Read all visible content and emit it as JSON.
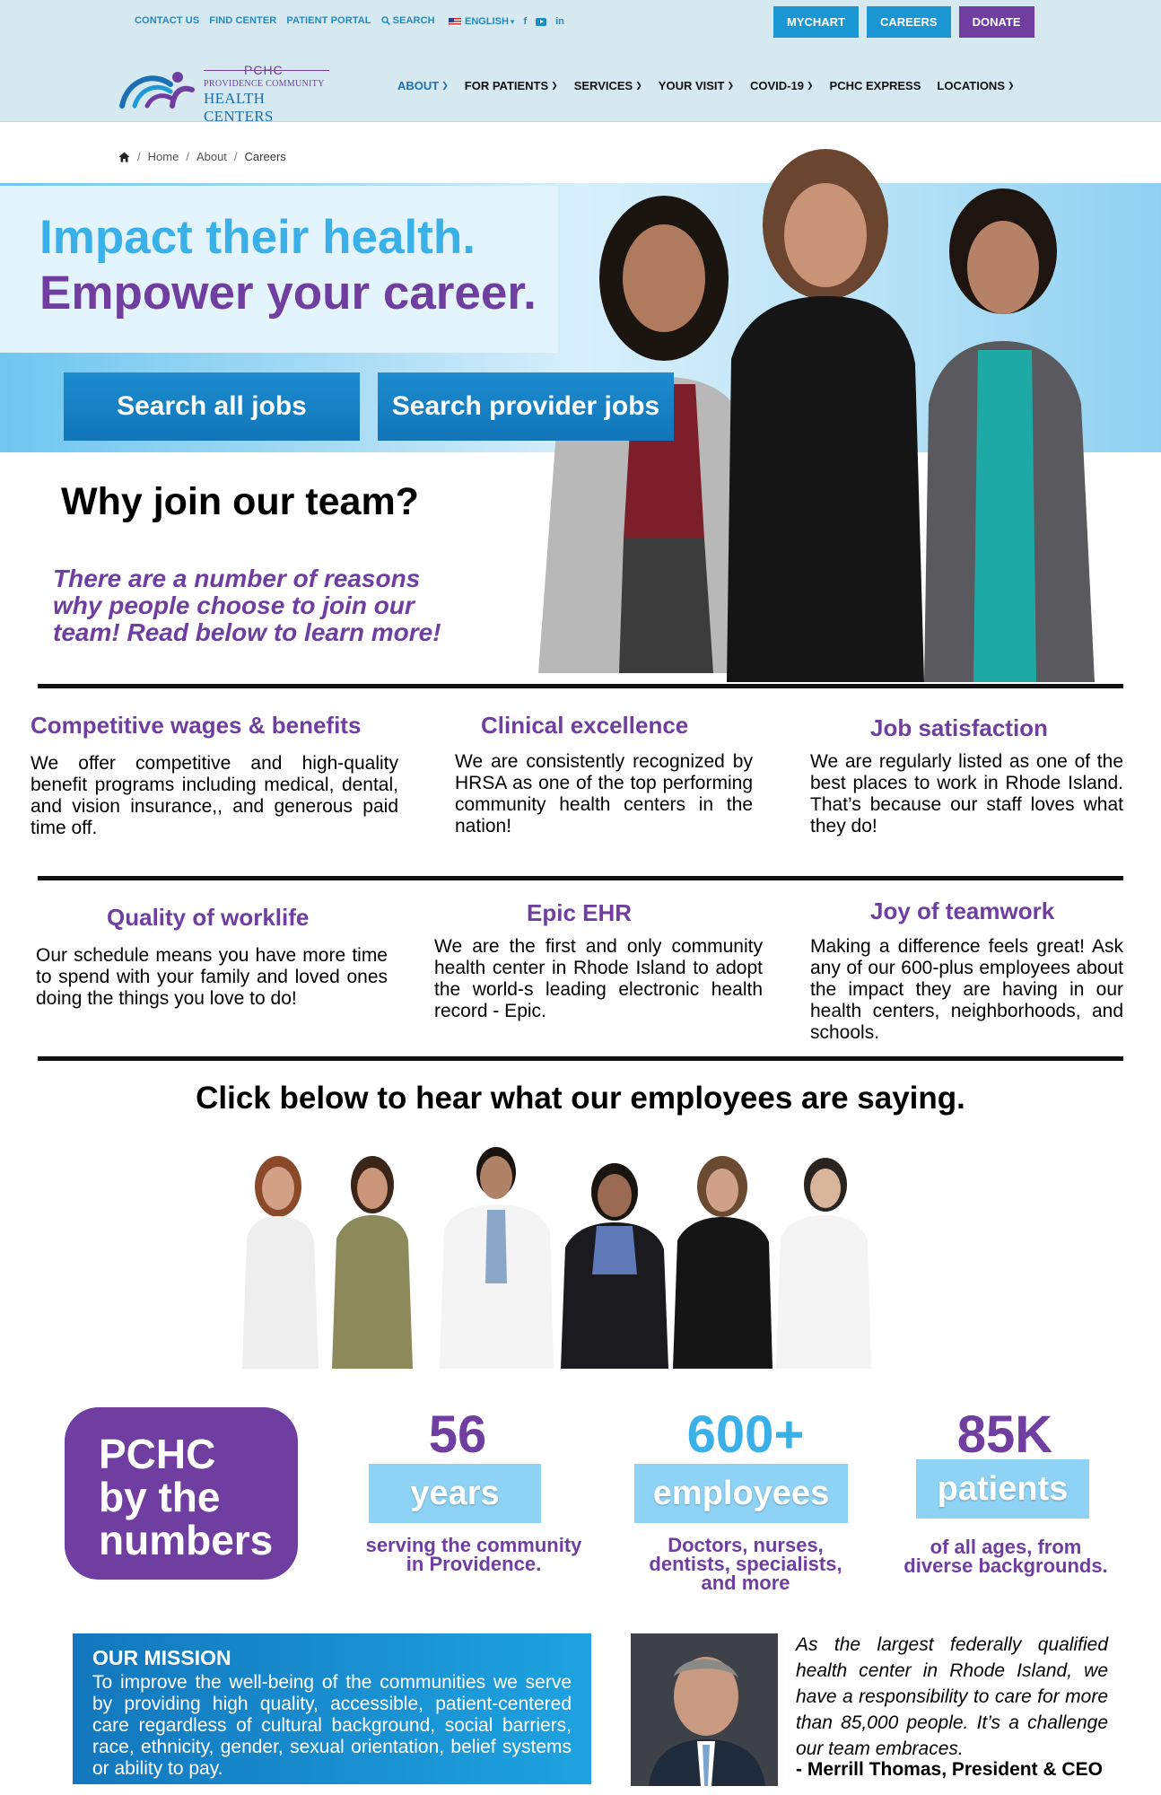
{
  "header": {
    "utility_links": [
      "CONTACT US",
      "FIND CENTER",
      "PATIENT PORTAL",
      "SEARCH"
    ],
    "language": "ENGLISH",
    "social": {
      "facebook": "f",
      "linkedin": "in"
    },
    "buttons": {
      "mychart": "MYCHART",
      "careers": "CAREERS",
      "donate": "DONATE"
    },
    "logo": {
      "abbr": "PCHC",
      "line1": "PROVIDENCE COMMUNITY",
      "line2": "HEALTH CENTERS"
    },
    "nav": [
      "ABOUT",
      "FOR PATIENTS",
      "SERVICES",
      "YOUR VISIT",
      "COVID-19",
      "PCHC EXPRESS",
      "LOCATIONS"
    ]
  },
  "breadcrumb": {
    "home": "Home",
    "about": "About",
    "current": "Careers"
  },
  "hero": {
    "line1": "Impact their health.",
    "line2": "Empower your career.",
    "btn_all": "Search all jobs",
    "btn_provider": "Search provider jobs"
  },
  "why": {
    "title": "Why join our team?",
    "subtitle": "There are a number of reasons why people choose to join our team! Read below to learn more!"
  },
  "reasons": [
    {
      "title": "Competitive  wages & benefits",
      "text": "We offer competitive and high-quality benefit programs including medical, dental, and vision insurance,, and generous paid time off."
    },
    {
      "title": "Clinical excellence",
      "text": "We are consistently recognized by HRSA as one of the top performing community health centers in the nation!"
    },
    {
      "title": "Job satisfaction",
      "text": "We are regularly listed as one of the best places to work in Rhode Island. That’s because our staff loves what they do!"
    },
    {
      "title": "Quality of worklife",
      "text": "Our schedule means you have more time to spend with your family and loved ones doing the things you love to do!"
    },
    {
      "title": "Epic EHR",
      "text": "We are the first and only community health center in Rhode Island to adopt the world-s leading electronic health record - Epic."
    },
    {
      "title": "Joy of teamwork",
      "text": "Making a difference feels great! Ask any of our 600-plus employees about the impact they are having in our health centers, neighborhoods, and schools."
    }
  ],
  "employees": {
    "title": "Click below to hear what our employees are saying."
  },
  "numbers": {
    "box": [
      "PCHC",
      "by the",
      "numbers"
    ],
    "stats": [
      {
        "value": "56",
        "label": "years",
        "desc1": "serving the community",
        "desc2": "in Providence.",
        "desc3": ""
      },
      {
        "value": "600+",
        "label": "employees",
        "desc1": "Doctors, nurses,",
        "desc2": "dentists, specialists,",
        "desc3": "and more"
      },
      {
        "value": "85K",
        "label": "patients",
        "desc1": "of all ages, from",
        "desc2": "diverse backgrounds.",
        "desc3": ""
      }
    ]
  },
  "mission": {
    "title": "OUR MISSION",
    "text": "To improve the well-being of the communities we serve by providing high quality, accessible, patient-centered care regardless of cultural background, social barriers, race, ethnicity, gender, sexual orientation, belief systems or ability to pay."
  },
  "ceo": {
    "quote": "As the largest federally qualified health center in Rhode Island, we have a responsibility to care for more than 85,000 people. It’s a challenge our team embraces.",
    "signature": "- Merrill Thomas, President & CEO"
  },
  "colors": {
    "brand_blue": "#1a97d3",
    "brand_purple": "#6f3ea0",
    "light_blue": "#3ab0e8",
    "header_bg": "#d6e8f0"
  }
}
